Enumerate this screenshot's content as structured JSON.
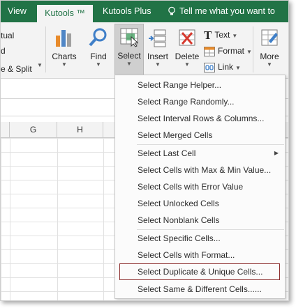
{
  "tabs": {
    "view": "View",
    "kutools": "Kutools ™",
    "kutools_plus": "Kutools Plus",
    "tell_me": "Tell me what you want to do..."
  },
  "ribbon": {
    "left_fragments": [
      "tual",
      "d",
      "e & Split"
    ],
    "charts": "Charts",
    "find": "Find",
    "select": "Select",
    "insert": "Insert",
    "delete": "Delete",
    "text": "Text",
    "format": "Format",
    "link": "Link",
    "more": "More"
  },
  "columns": [
    "G",
    "H"
  ],
  "menu": {
    "items": [
      "Select Range Helper...",
      "Select Range Randomly...",
      "Select Interval Rows & Columns...",
      "Select Merged Cells",
      "Select Last Cell",
      "Select Cells with Max & Min Value...",
      "Select Cells with Error Value",
      "Select Unlocked Cells",
      "Select Nonblank Cells",
      "Select Specific Cells...",
      "Select Cells with Format...",
      "Select Duplicate & Unique Cells...",
      "Select Same & Different Cells......"
    ]
  },
  "colors": {
    "ribbon_green": "#217346",
    "highlight_border": "#8b2c2c"
  },
  "icons": [
    "lightbulb-icon",
    "charts-icon",
    "find-icon",
    "select-icon",
    "insert-icon",
    "delete-icon",
    "text-icon",
    "format-icon",
    "link-icon",
    "more-icon",
    "submenu-arrow-icon"
  ]
}
